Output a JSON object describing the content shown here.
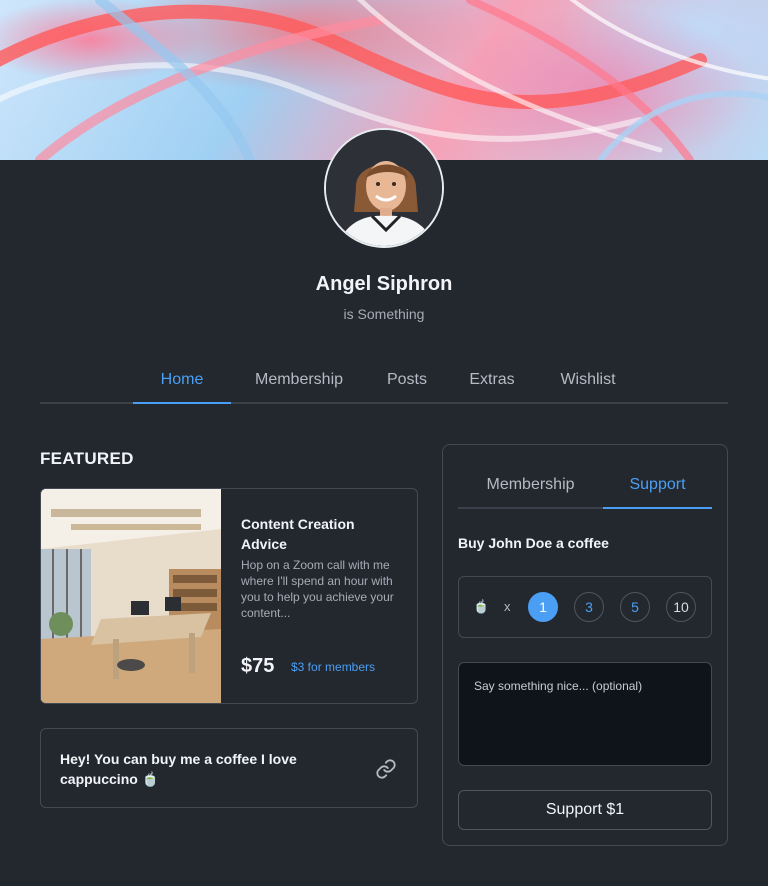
{
  "profile": {
    "name": "Angel Siphron",
    "tagline": "is Something"
  },
  "nav": {
    "tabs": [
      {
        "label": "Home",
        "active": true
      },
      {
        "label": "Membership",
        "active": false
      },
      {
        "label": "Posts",
        "active": false
      },
      {
        "label": "Extras",
        "active": false
      },
      {
        "label": "Wishlist",
        "active": false
      }
    ]
  },
  "featured": {
    "heading": "FEATURED",
    "card": {
      "title": "Content Creation Advice",
      "description": "Hop on a Zoom call with me where I'll spend an hour with you to help you achieve your content...",
      "price": "$75",
      "member_price": "$3 for members"
    },
    "note": {
      "text": "Hey! You can buy me a coffee I love cappuccino 🍵",
      "link_icon": "link-icon"
    }
  },
  "support_panel": {
    "tabs": [
      {
        "label": "Membership",
        "active": false
      },
      {
        "label": "Support",
        "active": true
      }
    ],
    "title": "Buy John Doe a coffee",
    "cup_icon": "🍵",
    "times": "x",
    "quantities": [
      "1",
      "3",
      "5",
      "10"
    ],
    "selected_quantity": "1",
    "message_placeholder": "Say something nice... (optional)",
    "button_label": "Support $1"
  },
  "colors": {
    "accent": "#4a9ff5",
    "background": "#23282f",
    "border": "#434a54"
  }
}
